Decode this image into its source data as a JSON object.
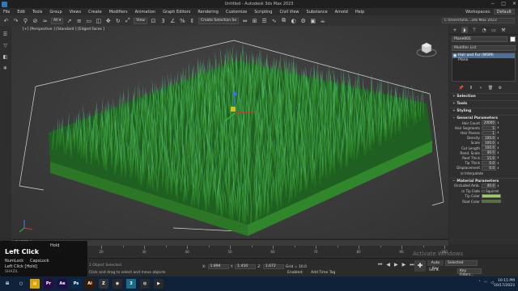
{
  "window": {
    "title": "Untitled - Autodesk 3ds Max 2023",
    "buttons": [
      "−",
      "□",
      "✕"
    ]
  },
  "menu": {
    "items": [
      "File",
      "Edit",
      "Tools",
      "Group",
      "Views",
      "Create",
      "Modifiers",
      "Animation",
      "Graph Editors",
      "Rendering",
      "Customize",
      "Scripting",
      "Civil View",
      "Substance",
      "Arnold",
      "Help"
    ],
    "workspaces_label": "Workspaces:",
    "workspace_value": "Default"
  },
  "toolbar": {
    "icons": [
      "undo-icon",
      "redo-icon",
      "link-icon",
      "unlink-icon",
      "bind-icon",
      "select-filter-icon",
      "select-icon",
      "select-by-name-icon",
      "region-select-icon",
      "window-crossing-icon",
      "move-icon",
      "rotate-icon",
      "scale-icon"
    ],
    "ref_coord": "View",
    "selection_set": "Create Selection Se",
    "project_path": "C:\\Users\\Sha...3ds Max 2023"
  },
  "viewport": {
    "label": "[+] [Perspective ] [Standard ] [Edged Faces ]",
    "grass_colors": {
      "base": "#2f8a2a",
      "mid": "#3fa338",
      "tip": "#5fe0d0",
      "edge": "#9ff0e0"
    }
  },
  "command_panel": {
    "tab_icons": [
      "create-icon",
      "modify-icon",
      "hierarchy-icon",
      "motion-icon",
      "display-icon",
      "utilities-icon"
    ],
    "object_name": "Plane001",
    "modifier_list": "Modifier List",
    "stack": [
      {
        "label": "Hair and Fur (WSM)",
        "selected": true
      },
      {
        "label": "Plane",
        "selected": false
      }
    ],
    "rollouts": [
      "Selection",
      "Tools",
      "Styling",
      "General Parameters"
    ],
    "general_params": [
      {
        "label": "Hair Count",
        "value": "20000"
      },
      {
        "label": "Hair Segments",
        "value": "5"
      },
      {
        "label": "Hair Passes",
        "value": "1"
      },
      {
        "label": "Density",
        "value": "100.0"
      },
      {
        "label": "Scale",
        "value": "100.0"
      },
      {
        "label": "Cut Length",
        "value": "100.0"
      },
      {
        "label": "Rand. Scale",
        "value": "40.0"
      },
      {
        "label": "Root Thick",
        "value": "15.0"
      },
      {
        "label": "Tip Thick",
        "value": "0.0"
      },
      {
        "label": "Displacement",
        "value": "0.0"
      }
    ],
    "interpolate_label": "Interpolate",
    "material_rollout": "Material Parameters",
    "material_params": [
      {
        "label": "Occluded Amb.",
        "value": "40.0"
      }
    ],
    "tip_fade_label": "Tip Fade",
    "squirrel_label": "Squirrel",
    "tip_color_label": "Tip Color",
    "root_color_label": "Root Color",
    "tip_color": "#9fcf5a",
    "root_color": "#4a7a2a"
  },
  "timeline": {
    "slider_label": "0 / 100",
    "ruler": [
      "0",
      "10",
      "20",
      "30",
      "40",
      "50",
      "60",
      "70",
      "80",
      "90",
      "100"
    ]
  },
  "status": {
    "x_label": "X:",
    "x_value": "1.894",
    "y_label": "Y:",
    "y_value": "1.410",
    "z_label": "Z:",
    "z_value": "1.672",
    "grid_label": "Grid = 10.0",
    "enabled_label": "Enabled:",
    "add_time_tag": "Add Time Tag",
    "prompt": "Click and drag to select and move objects",
    "selected_count": "1 Object Selected",
    "auto_key": "Auto Key",
    "selected_dropdown": "Selected",
    "set_key": "Set K.",
    "key_filters": "Key Filters..."
  },
  "key_overlay": {
    "big": "Left Click",
    "hold": "Hold",
    "numlock": "NumLock",
    "capslock": "CapsLock",
    "row2": "Left Click [Hold]",
    "row3": "SHAZIL"
  },
  "activate_watermark": "Activate Windows",
  "taskbar": {
    "apps": [
      {
        "name": "start-icon",
        "label": "⊞",
        "color": "#10213a"
      },
      {
        "name": "search-icon",
        "label": "○",
        "color": "#10213a"
      },
      {
        "name": "file-explorer-icon",
        "label": "▤",
        "color": "#d9a400"
      },
      {
        "name": "premiere-icon",
        "label": "Pr",
        "color": "#2a0b4a"
      },
      {
        "name": "after-effects-icon",
        "label": "Ae",
        "color": "#1c0d4a"
      },
      {
        "name": "photoshop-icon",
        "label": "Ps",
        "color": "#0a2a4a"
      },
      {
        "name": "illustrator-icon",
        "label": "Ai",
        "color": "#3a1a00"
      },
      {
        "name": "zbrush-icon",
        "label": "Z",
        "color": "#333333"
      },
      {
        "name": "blender-icon",
        "label": "◉",
        "color": "#2a2a2a"
      },
      {
        "name": "3dsmax-icon",
        "label": "3",
        "color": "#1a6a8a"
      },
      {
        "name": "chrome-icon",
        "label": "◍",
        "color": "#2a2a2a"
      },
      {
        "name": "media-icon",
        "label": "▶",
        "color": "#2a2a2a"
      }
    ],
    "time": "10:15 PM",
    "date": "10/17/2023"
  }
}
